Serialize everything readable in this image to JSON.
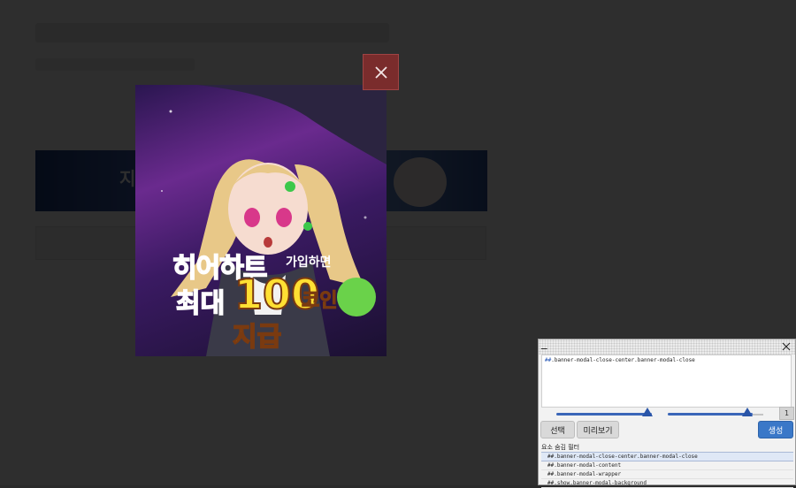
{
  "modal": {
    "close_glyph": "×",
    "promo": {
      "line1": "히어하트",
      "line1_small": "가입하면",
      "line2_prefix": "최대",
      "amount": "100",
      "unit": "코인",
      "line3": "지급"
    }
  },
  "background": {
    "banner_text": "지"
  },
  "filter_panel": {
    "minimize_glyph": "_",
    "close_glyph": "×",
    "rule_prefix": "##",
    "rule_text": ".banner-modal-close-center.banner-modal-close",
    "count": "1",
    "select_label": "선택",
    "preview_label": "미리보기",
    "create_label": "생성",
    "list_title": "요소 숨김 필터",
    "rules": [
      "##.banner-modal-close-center.banner-modal-close",
      "##.banner-modal-content",
      "##.banner-modal-wrapper",
      "##.show.banner-modal-background"
    ]
  },
  "colors": {
    "overlay": "#000000",
    "close_button": "#7a2c2c",
    "accent_blue": "#3a78c8"
  }
}
